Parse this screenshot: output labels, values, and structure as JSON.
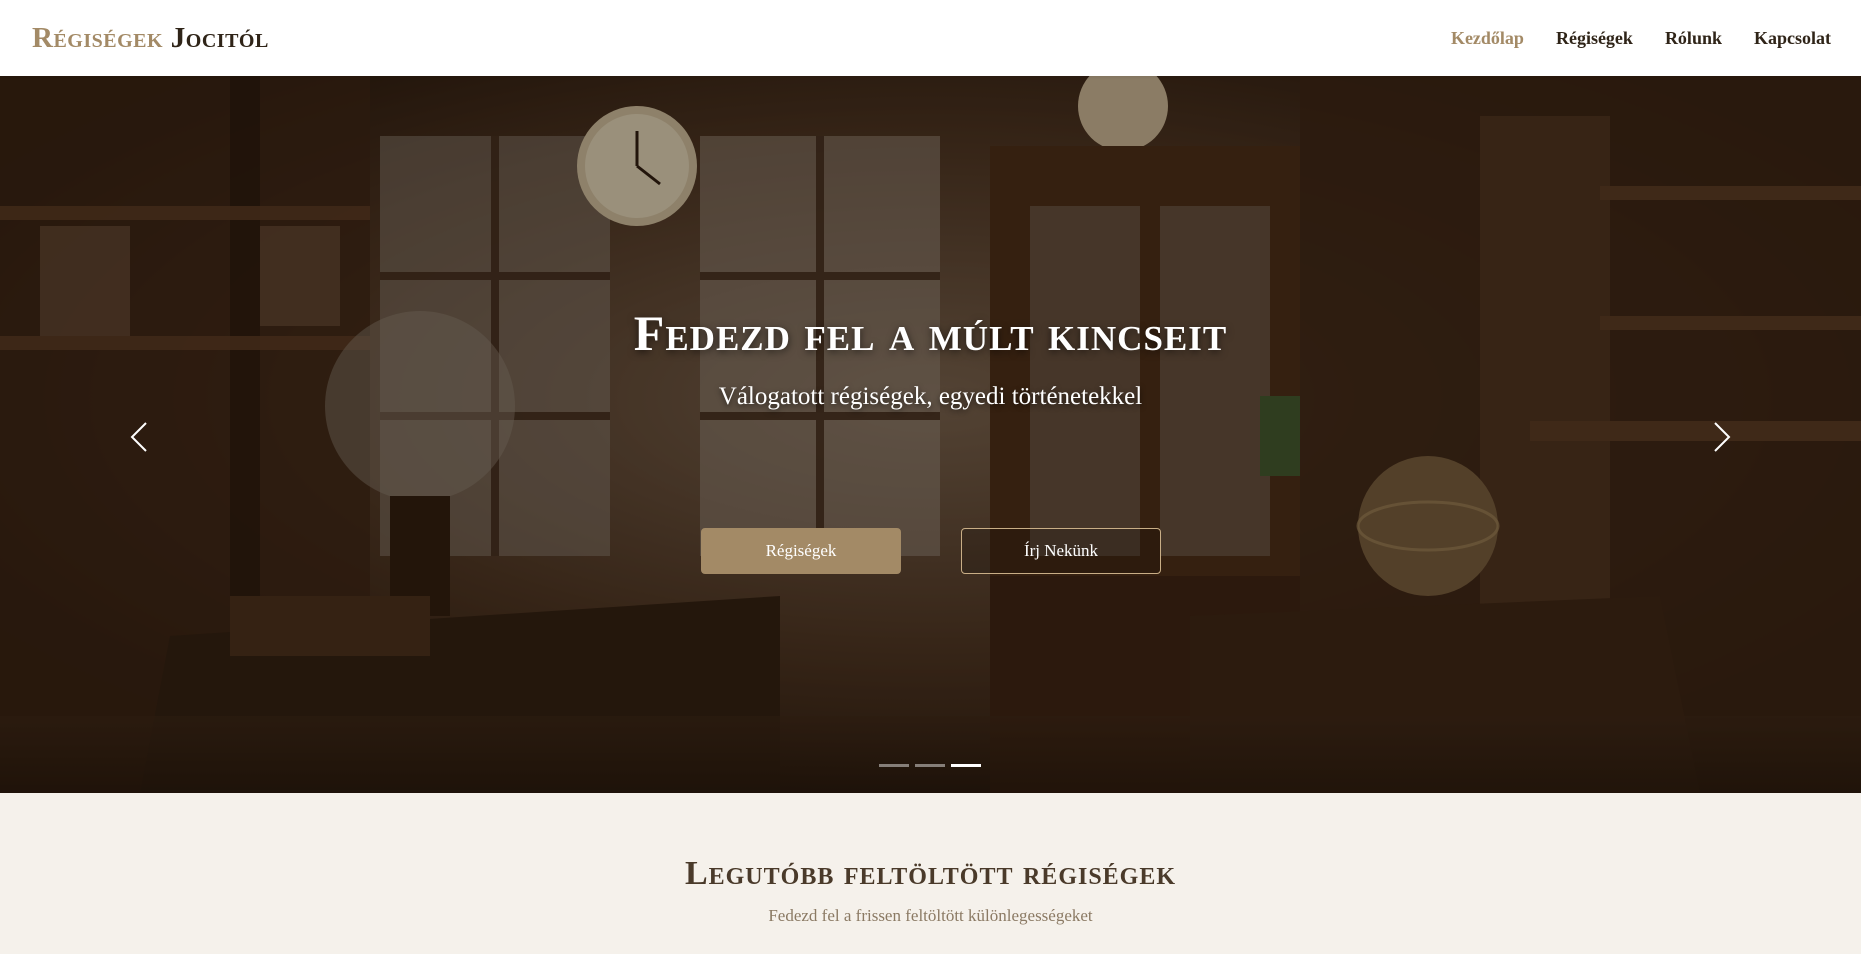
{
  "header": {
    "logo_part1": "Régiségek",
    "logo_part2": "Jocitól",
    "nav": [
      {
        "label": "Kezdőlap",
        "active": true
      },
      {
        "label": "Régiségek",
        "active": false
      },
      {
        "label": "Rólunk",
        "active": false
      },
      {
        "label": "Kapcsolat",
        "active": false
      }
    ]
  },
  "hero": {
    "title": "Fedezd fel a múlt kincseit",
    "subtitle": "Válogatott régiségek, egyedi történetekkel",
    "primary_button": "Régiségek",
    "secondary_button": "Írj Nekünk",
    "slides": 3,
    "active_slide": 3,
    "prev_icon": "chevron-left-icon",
    "next_icon": "chevron-right-icon"
  },
  "recent": {
    "title": "Legutóbb feltöltött régiségek",
    "subtitle": "Fedezd fel a frissen feltöltött különlegességeket"
  },
  "colors": {
    "accent": "#a38a66",
    "dark_text": "#2f2418",
    "section_bg": "#f5f1eb"
  }
}
